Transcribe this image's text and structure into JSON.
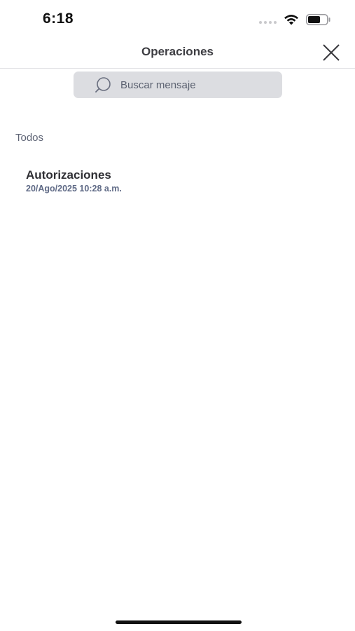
{
  "status_bar": {
    "time": "6:18"
  },
  "header": {
    "title": "Operaciones",
    "close_icon": "close-x-icon"
  },
  "search": {
    "placeholder": "Buscar mensaje",
    "icon": "search-icon"
  },
  "filter": {
    "label": "Todos"
  },
  "items": [
    {
      "title": "Autorizaciones",
      "date": "20/Ago/2025 10:28 a.m."
    }
  ]
}
